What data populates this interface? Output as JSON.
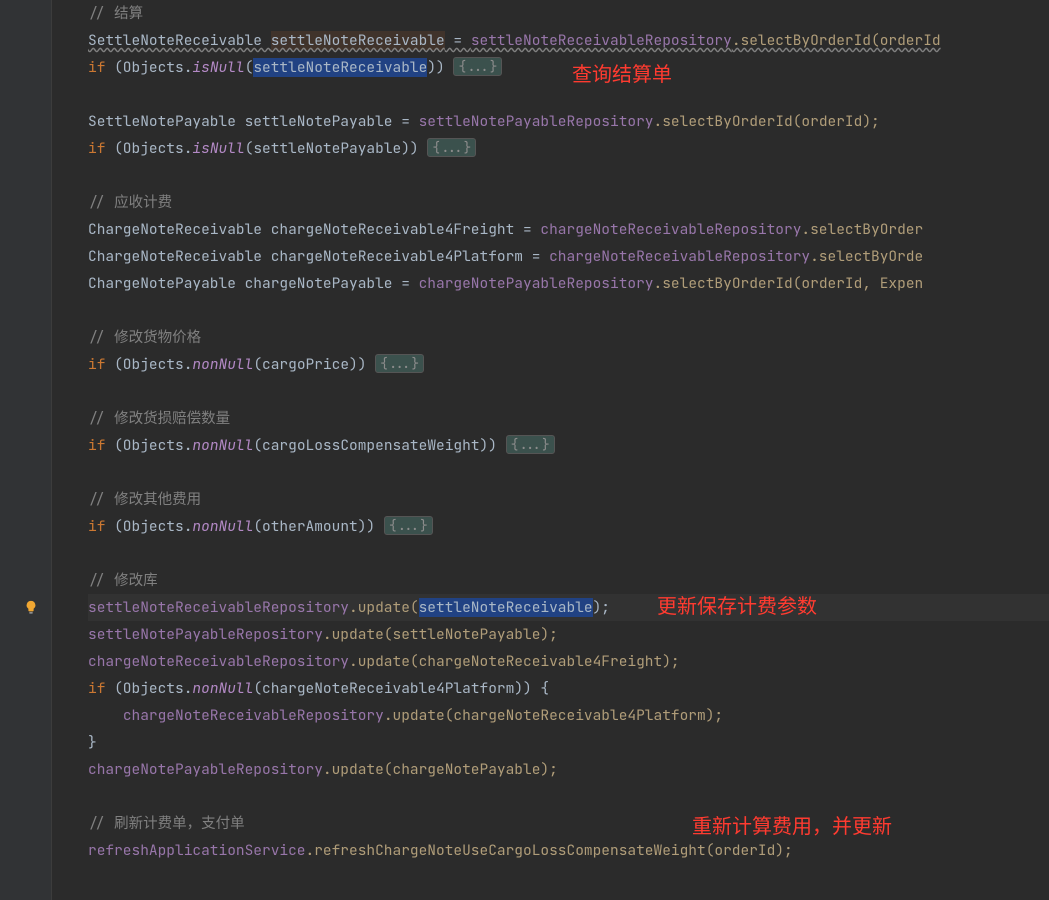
{
  "gutter": {
    "bulbTop": 600
  },
  "annotations": {
    "a1": "查询结算单",
    "a2": "更新保存计费参数",
    "a3": "重新计算费用，并更新"
  },
  "fold": "{...}",
  "lines": {
    "c_settle": "// 结算",
    "l1_a": "SettleNoteReceivable ",
    "l1_b": "settleNoteReceivable",
    "l1_c": " = ",
    "l1_d": "settleNoteReceivableRepository",
    "l1_e": ".selectByOrderId(orderId",
    "l2_a": "if ",
    "l2_b": "(Objects.",
    "l2_c": "isNull",
    "l2_d": "(",
    "l2_e": "settleNoteReceivable",
    "l2_f": ")) ",
    "l3_a": "SettleNotePayable settleNotePayable = ",
    "l3_b": "settleNotePayableRepository",
    "l3_c": ".selectByOrderId(orderId);",
    "l4_a": "if ",
    "l4_b": "(Objects.",
    "l4_c": "isNull",
    "l4_d": "(settleNotePayable)) ",
    "c_recv": "// 应收计费",
    "l5_a": "ChargeNoteReceivable chargeNoteReceivable4Freight = ",
    "l5_b": "chargeNoteReceivableRepository",
    "l5_c": ".selectByOrder",
    "l6_a": "ChargeNoteReceivable chargeNoteReceivable4Platform = ",
    "l6_b": "chargeNoteReceivableRepository",
    "l6_c": ".selectByOrde",
    "l7_a": "ChargeNotePayable chargeNotePayable = ",
    "l7_b": "chargeNotePayableRepository",
    "l7_c": ".selectByOrderId(orderId, Expen",
    "c_cargo": "// 修改货物价格",
    "l8_a": "if ",
    "l8_b": "(Objects.",
    "l8_c": "nonNull",
    "l8_d": "(cargoPrice)) ",
    "c_loss": "// 修改货损赔偿数量",
    "l9_a": "if ",
    "l9_b": "(Objects.",
    "l9_c": "nonNull",
    "l9_d": "(cargoLossCompensateWeight)) ",
    "c_other": "// 修改其他费用",
    "l10_a": "if ",
    "l10_b": "(Objects.",
    "l10_c": "nonNull",
    "l10_d": "(otherAmount)) ",
    "c_store": "// 修改库",
    "l11_a": "settleNoteReceivableRepository",
    "l11_b": ".update(",
    "l11_c": "settleNoteReceivable",
    "l11_d": ");",
    "l12_a": "settleNotePayableRepository",
    "l12_b": ".update(settleNotePayable);",
    "l13_a": "chargeNoteReceivableRepository",
    "l13_b": ".update(chargeNoteReceivable4Freight);",
    "l14_a": "if ",
    "l14_b": "(Objects.",
    "l14_c": "nonNull",
    "l14_d": "(chargeNoteReceivable4Platform)) {",
    "l15_a": "    ",
    "l15_b": "chargeNoteReceivableRepository",
    "l15_c": ".update(chargeNoteReceivable4Platform);",
    "l16": "}",
    "l17_a": "chargeNotePayableRepository",
    "l17_b": ".update(chargeNotePayable);",
    "c_refresh": "// 刷新计费单，支付单",
    "l18_a": "refreshApplicationService",
    "l18_b": ".refreshChargeNoteUseCargoLossCompensateWeight(orderId);"
  }
}
